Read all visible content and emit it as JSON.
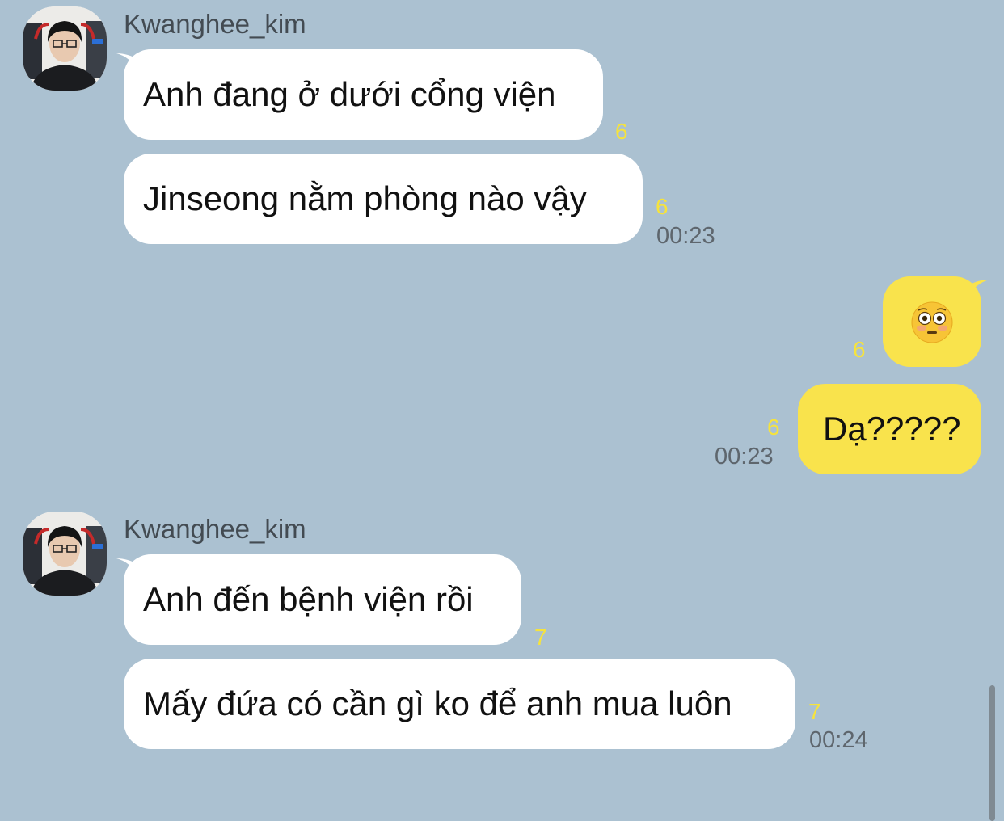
{
  "messages_group_1": {
    "sender": "Kwanghee_kim",
    "msg1": {
      "text": "Anh đang ở dưới cổng viện",
      "unread": "6"
    },
    "msg2": {
      "text": "Jinseong nằm phòng nào vậy",
      "unread": "6",
      "time": "00:23"
    }
  },
  "messages_mine": {
    "msg1": {
      "emoji": "flushed-face",
      "unread": "6"
    },
    "msg2": {
      "text": "Dạ?????",
      "unread": "6",
      "time": "00:23"
    }
  },
  "messages_group_2": {
    "sender": "Kwanghee_kim",
    "msg1": {
      "text": "Anh đến bệnh viện rồi",
      "unread": "7"
    },
    "msg2": {
      "text": "Mấy đứa có cần gì ko để anh mua luôn",
      "unread": "7",
      "time": "00:24"
    }
  },
  "colors": {
    "background": "#abc1d1",
    "incoming_bubble": "#ffffff",
    "outgoing_bubble": "#f9e34c",
    "unread_count": "#f6e33c",
    "timestamp": "#5e666d"
  }
}
